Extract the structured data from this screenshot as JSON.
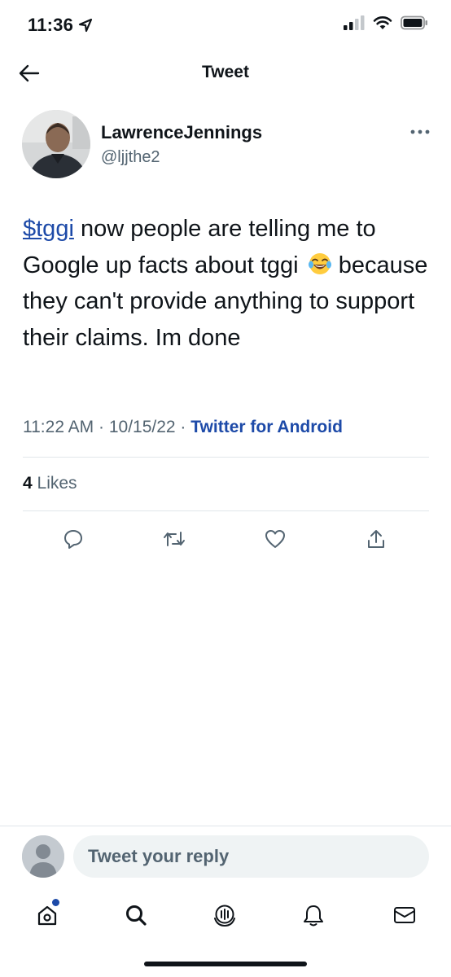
{
  "status_bar": {
    "time": "11:36",
    "location_icon": "location-arrow-icon",
    "signal_icon": "cellular-signal-icon",
    "wifi_icon": "wifi-icon",
    "battery_icon": "battery-icon"
  },
  "header": {
    "title": "Tweet",
    "back_icon": "back-arrow-icon"
  },
  "author": {
    "display_name": "LawrenceJennings",
    "handle": "@ljjthe2",
    "more_icon": "more-options-icon"
  },
  "tweet": {
    "cashtag": "$tggi",
    "text_part1": " now people are telling me to Google up facts about tggi",
    "emoji_icon": "face-with-tears-of-joy-icon",
    "text_part2": " because they can't provide anything to support their claims. Im done",
    "time": "11:22 AM",
    "separator": " · ",
    "date": "10/15/22",
    "source": "Twitter for Android"
  },
  "engagement": {
    "likes_count": "4",
    "likes_label": " Likes"
  },
  "actions": {
    "reply_icon": "reply-icon",
    "retweet_icon": "retweet-icon",
    "like_icon": "heart-icon",
    "share_icon": "share-icon"
  },
  "reply_bar": {
    "placeholder": "Tweet your reply"
  },
  "tab_bar": {
    "home_icon": "home-icon",
    "search_icon": "search-icon",
    "spaces_icon": "spaces-icon",
    "notifications_icon": "bell-icon",
    "messages_icon": "mail-icon"
  },
  "colors": {
    "link": "#1d4aa8",
    "text": "#0f1419",
    "secondary": "#536471",
    "divider": "#e1e6ea"
  }
}
